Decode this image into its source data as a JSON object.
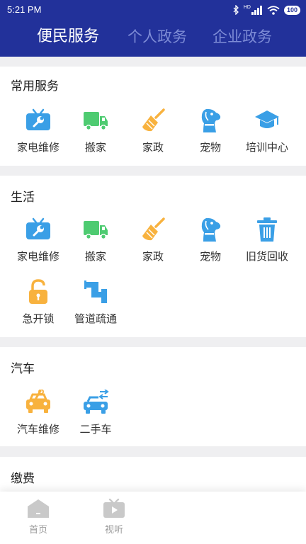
{
  "status": {
    "time": "5:21 PM",
    "battery": "100",
    "network": "HD"
  },
  "tabs": [
    {
      "label": "便民服务",
      "active": true
    },
    {
      "label": "个人政务",
      "active": false
    },
    {
      "label": "企业政务",
      "active": false
    }
  ],
  "colors": {
    "header": "#22319a",
    "blue": "#3a9fe6",
    "green": "#4ecb71",
    "orange": "#f8b23e",
    "gray": "#c9c9c9"
  },
  "sections": {
    "common": {
      "title": "常用服务",
      "items": [
        {
          "label": "家电维修",
          "icon": "tv-repair-icon"
        },
        {
          "label": "搬家",
          "icon": "truck-icon"
        },
        {
          "label": "家政",
          "icon": "broom-icon"
        },
        {
          "label": "宠物",
          "icon": "dog-icon"
        },
        {
          "label": "培训中心",
          "icon": "graduation-cap-icon"
        }
      ]
    },
    "life": {
      "title": "生活",
      "items": [
        {
          "label": "家电维修",
          "icon": "tv-repair-icon"
        },
        {
          "label": "搬家",
          "icon": "truck-icon"
        },
        {
          "label": "家政",
          "icon": "broom-icon"
        },
        {
          "label": "宠物",
          "icon": "dog-icon"
        },
        {
          "label": "旧货回收",
          "icon": "trash-icon"
        },
        {
          "label": "急开锁",
          "icon": "unlock-icon"
        },
        {
          "label": "管道疏通",
          "icon": "pipe-icon"
        }
      ]
    },
    "car": {
      "title": "汽车",
      "items": [
        {
          "label": "汽车维修",
          "icon": "car-repair-icon"
        },
        {
          "label": "二手车",
          "icon": "used-car-icon"
        }
      ]
    },
    "fees": {
      "title": "缴费"
    }
  },
  "bottom_nav": [
    {
      "label": "首页",
      "icon": "home-icon"
    },
    {
      "label": "视听",
      "icon": "video-icon"
    }
  ]
}
